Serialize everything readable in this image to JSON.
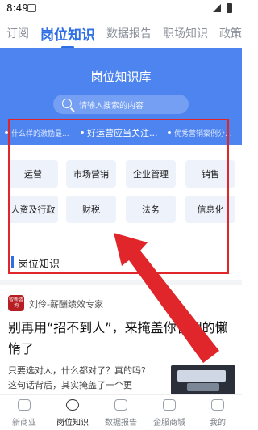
{
  "status": {
    "time": "8:49"
  },
  "tabs": [
    "订阅",
    "岗位知识",
    "数据报告",
    "职场知识",
    "政策"
  ],
  "banner": {
    "title": "岗位知识库",
    "search_placeholder": "请输入搜索的内容"
  },
  "ticker": [
    "什么样的激励最...",
    "好运营应当关注...",
    "优秀营销案例分..."
  ],
  "categories": [
    "运营",
    "市场营销",
    "企业管理",
    "销售",
    "人资及行政",
    "财税",
    "法务",
    "信息化"
  ],
  "section": {
    "title": "岗位知识"
  },
  "article": {
    "avatar_text": "智新咨询",
    "author": "刘伶-薪酬绩效专家",
    "title": "别再用“招不到人”，来掩盖你管理的懒惰了",
    "snippet_line1": "只要选对人，什么都对了？真的吗?",
    "snippet_line2": "这句话背后，其实掩盖了一个更"
  },
  "bottom_nav": [
    "新商业",
    "岗位知识",
    "数据报告",
    "企服商城",
    "我的"
  ],
  "colors": {
    "accent": "#2f6fe6",
    "banner": "#4d84ef",
    "annotation": "#e0262b"
  }
}
